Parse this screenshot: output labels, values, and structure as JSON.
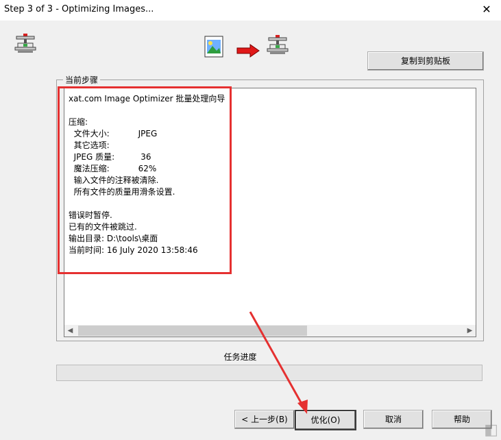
{
  "window": {
    "title": "Step 3 of 3 - Optimizing Images...",
    "close_glyph": "✕"
  },
  "icons": [
    "vise-clamp-icon",
    "image-file-icon",
    "red-arrow-right-icon",
    "vise-clamp-icon"
  ],
  "copy_button": {
    "label": "复制到剪贴板"
  },
  "group": {
    "label": "当前步骤"
  },
  "log": {
    "lines": [
      "xat.com Image Optimizer 批量处理向导",
      "",
      "压缩:",
      "  文件大小:           JPEG",
      "  其它选项:",
      "  JPEG 质量:          36",
      "  魔法压缩:           62%",
      "  输入文件的注释被清除.",
      "  所有文件的质量用滑条设置.",
      "",
      "错误时暂停.",
      "已有的文件被跳过.",
      "输出目录: D:\\tools\\桌面",
      "当前时间: 16 July 2020 13:58:46"
    ]
  },
  "progress": {
    "label": "任务进度",
    "value": 0
  },
  "buttons": {
    "back": "< 上一步(B)",
    "optimize": "优化(O)",
    "cancel": "取消",
    "help": "帮助"
  },
  "colors": {
    "highlight_red": "#e53030",
    "progress_green": "#06b025"
  }
}
